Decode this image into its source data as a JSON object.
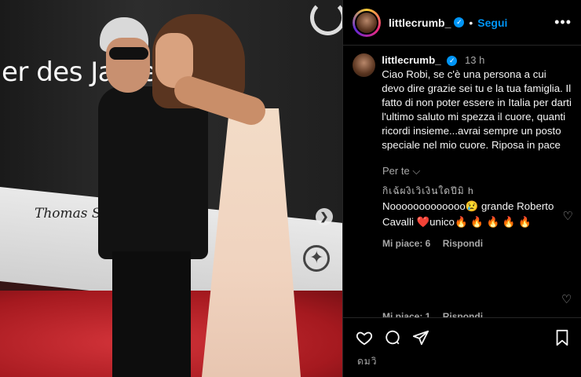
{
  "photo": {
    "banner_text": "er des Jahres 20",
    "sponsor_text": "Thomas Sabo"
  },
  "header": {
    "username": "littlecrumb_",
    "separator": "•",
    "follow_label": "Segui",
    "more_label": "•••"
  },
  "caption": {
    "username": "littlecrumb_",
    "time": "13 h",
    "text": "Ciao Robi, se c'è una persona a cui devo dire grazie sei tu e la tua famiglia. Il fatto di non poter essere in Italia per darti l'ultimo saluto mi spezza il cuore, quanti ricordi insieme...avrai sempre un posto speciale nel mio cuore. Riposa in pace"
  },
  "translate_label": "Per te",
  "comment": {
    "garbled_header": "กิเฉ้ผงิเวิเงินใดปีมิ h",
    "text": "Nooooooooooooo😢 grande Roberto Cavalli ❤️unico🔥 🔥 🔥 🔥 🔥",
    "likes_label": "Mi piace: 6",
    "reply_label": "Rispondi"
  },
  "cut_comment": {
    "likes_label": "Mi piace: 1",
    "reply_label": "Rispondi"
  },
  "likers_text": "ดมวิ",
  "colors": {
    "accent": "#0095f6",
    "background": "#000000",
    "muted": "#a8a8a8"
  },
  "icons": [
    "heart-icon",
    "comment-icon",
    "share-icon",
    "bookmark-icon",
    "more-icon",
    "verified-icon",
    "chevron-down-icon",
    "chevron-right-icon"
  ]
}
